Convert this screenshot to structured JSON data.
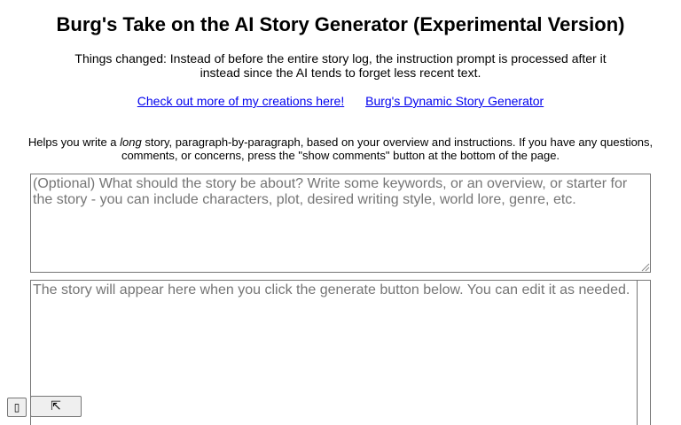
{
  "header": {
    "title": "Burg's Take on the AI Story Generator (Experimental Version)"
  },
  "changes_note": "Things changed: Instead of before the entire story log, the instruction prompt is processed after it instead since the AI tends to forget less recent text.",
  "links": {
    "creations": "Check out more of my creations here!",
    "dynamic": "Burg's Dynamic Story Generator"
  },
  "intro": {
    "before": "Helps you write a ",
    "emphasis": "long",
    "after": " story, paragraph-by-paragraph, based on your overview and instructions. If you have any questions, comments, or concerns, press the \"show comments\" button at the bottom of the page."
  },
  "overview_input": {
    "value": "",
    "placeholder": "(Optional) What should the story be about? Write some keywords, or an overview, or starter for the story - you can include characters, plot, desired writing style, world lore, genre, etc."
  },
  "story_output": {
    "value": "",
    "placeholder": "The story will appear here when you click the generate button below. You can edit it as needed."
  },
  "bottom_controls": {
    "small_button_glyph": "▯",
    "wide_button_glyph": "⇱"
  }
}
